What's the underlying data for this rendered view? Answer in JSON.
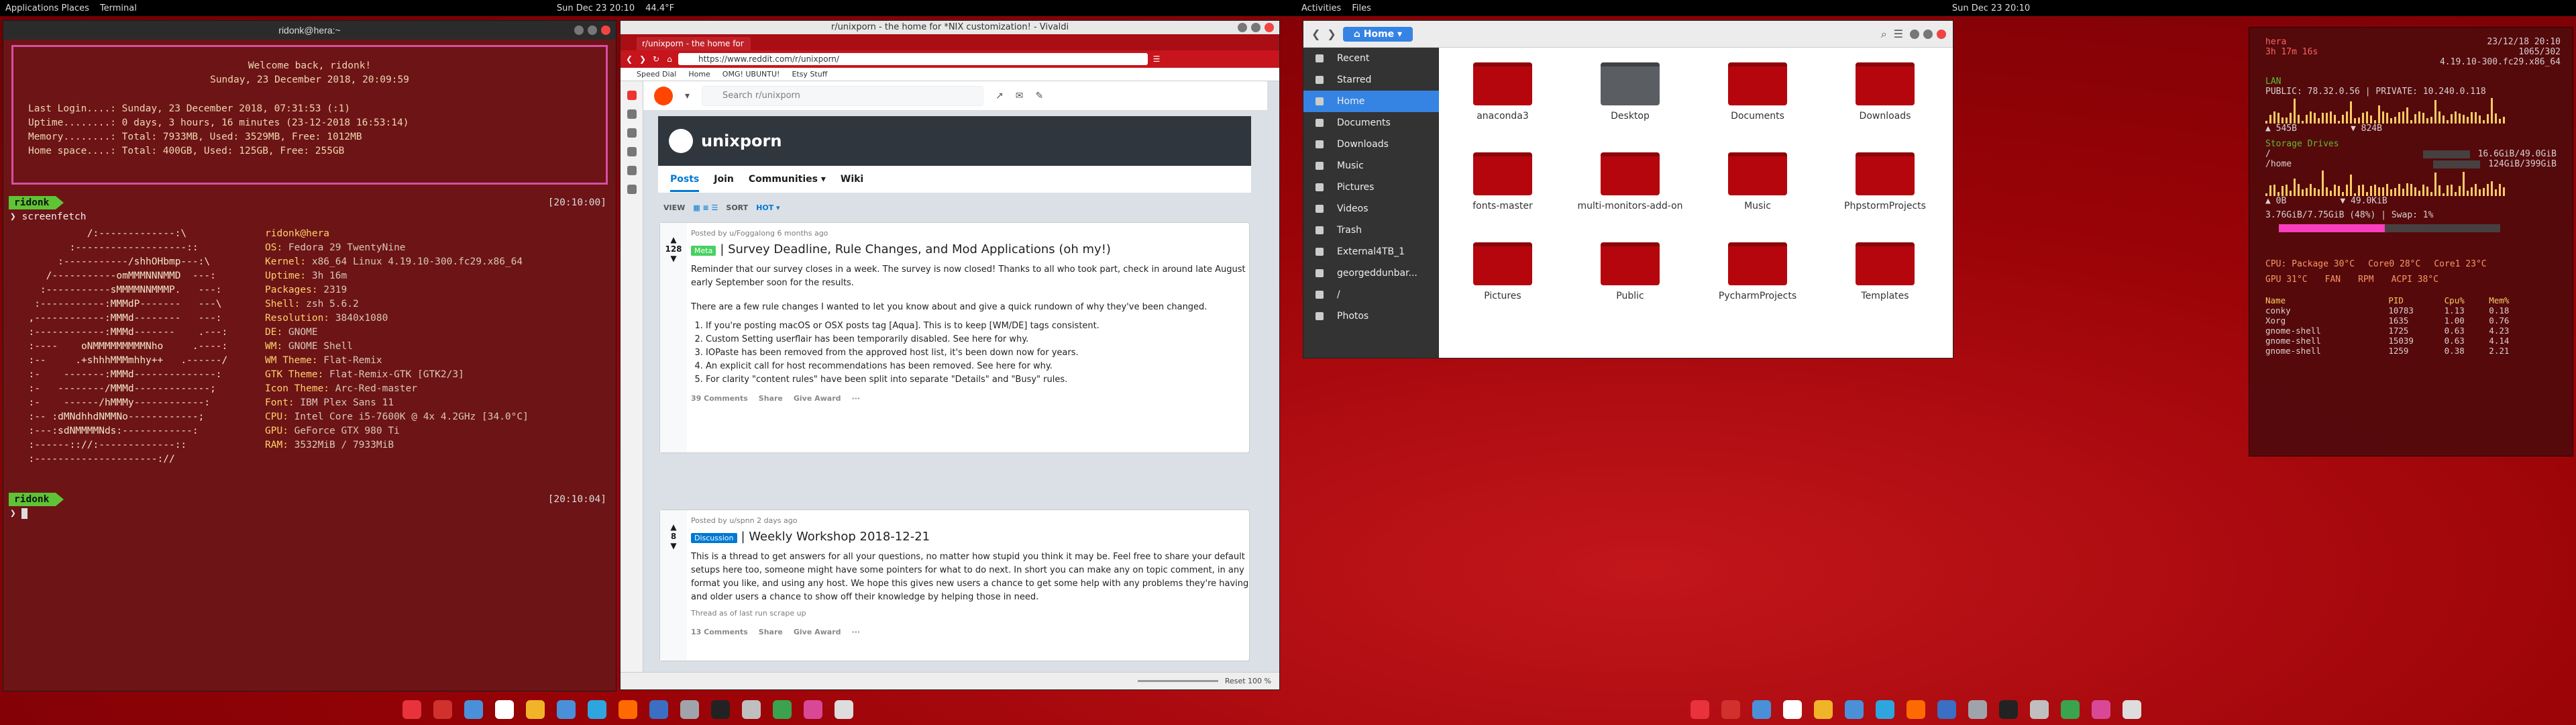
{
  "topbars": [
    {
      "left": "Applications  Places",
      "app": "Terminal",
      "clock": "Sun Dec 23  20:10",
      "extra": "44.4°F"
    },
    {
      "left": "Activities",
      "app": "Files",
      "clock": "Sun Dec 23  20:10",
      "extra": ""
    }
  ],
  "terminal": {
    "title": "ridonk@hera:~",
    "welcome_line1": "Welcome back, ridonk!",
    "welcome_line2": "Sunday, 23 December 2018, 20:09:59",
    "stats": [
      "Last Login....: Sunday, 23 December 2018, 07:31:53 (:1)",
      "Uptime........: 0 days, 3 hours, 16 minutes (23-12-2018 16:53:14)",
      "Memory........: Total: 7933MB, Used: 3529MB, Free: 1012MB",
      "Home space....: Total: 400GB, Used: 125GB, Free: 255GB"
    ],
    "prompt_user": "ridonk",
    "command": "screenfetch",
    "time1": "[20:10:00]",
    "time2": "[20:10:04]",
    "art": [
      "            /:-------------:\\",
      "         :-------------------::",
      "       :-----------/shhOHbmp---:\\",
      "     /-----------omMMMNNNMMD  ---:",
      "    :-----------sMMMMNNMMMP.   ---:",
      "   :-----------:MMMdP-------   ---\\",
      "  ,------------:MMMd--------   ---:",
      "  :------------:MMMd-------    .---:",
      "  :----    oNMMMMMMMMMNho     .----:",
      "  :--     .+shhhMMMmhhy++   .------/",
      "  :-    -------:MMMd--------------:",
      "  :-   --------/MMMd-------------;",
      "  :-    ------/hMMMy------------:",
      "  :-- :dMNdhhdNMMNo------------;",
      "  :---:sdNMMMMNds:------------:",
      "  :------:://:-------------::",
      "  :---------------------://"
    ],
    "info": [
      [
        "ridonk@hera",
        ""
      ],
      [
        "OS:",
        "Fedora 29 TwentyNine"
      ],
      [
        "Kernel:",
        "x86_64 Linux 4.19.10-300.fc29.x86_64"
      ],
      [
        "Uptime:",
        "3h 16m"
      ],
      [
        "Packages:",
        "2319"
      ],
      [
        "Shell:",
        "zsh 5.6.2"
      ],
      [
        "Resolution:",
        "3840x1080"
      ],
      [
        "DE:",
        "GNOME"
      ],
      [
        "WM:",
        "GNOME Shell"
      ],
      [
        "WM Theme:",
        "Flat-Remix"
      ],
      [
        "GTK Theme:",
        "Flat-Remix-GTK [GTK2/3]"
      ],
      [
        "Icon Theme:",
        "Arc-Red-master"
      ],
      [
        "Font:",
        "IBM Plex Sans 11"
      ],
      [
        "CPU:",
        "Intel Core i5-7600K @ 4x 4.2GHz [34.0°C]"
      ],
      [
        "GPU:",
        "GeForce GTX 980 Ti"
      ],
      [
        "RAM:",
        "3532MiB / 7933MiB"
      ]
    ]
  },
  "browser": {
    "title": "r/unixporn - the home for *NIX customization! - Vivaldi",
    "tab": "r/unixporn - the home for",
    "url": "https://www.reddit.com/r/unixporn/",
    "bookmarks": [
      "Speed Dial",
      "Home",
      "OMG! UBUNTU!",
      "Etsy Stuff"
    ],
    "search_placeholder": "Search r/unixporn",
    "sub_name": "unixporn",
    "nav": [
      "Posts",
      "Join",
      "Communities ▾",
      "Wiki"
    ],
    "view_label": "VIEW",
    "sort_label": "SORT",
    "sort_value": "HOT ▾",
    "post1": {
      "votes": "128",
      "meta": "Posted by u/Foggalong   6 months ago",
      "flair": "Meta",
      "title": "| Survey Deadline, Rule Changes, and Mod Applications (oh my!)",
      "intro": "Reminder that our survey closes in a week. The survey is now closed! Thanks to all who took part, check in around late August early September soon for the results.",
      "para": "There are a few rule changes I wanted to let you know about and give a quick rundown of why they've been changed.",
      "items": [
        "If you're posting macOS or OSX posts tag [Aqua]. This is to keep [WM/DE] tags consistent.",
        "Custom Setting userflair has been temporarily disabled. See here for why.",
        "IOPaste has been removed from the approved host list, it's been down now for years.",
        "An explicit call for host recommendations has been removed. See here for why.",
        "For clarity \"content rules\" have been split into separate \"Details\" and \"Busy\" rules."
      ],
      "footer": [
        "39 Comments",
        "Share",
        "Give Award",
        "···"
      ]
    },
    "post2": {
      "votes": "8",
      "meta": "Posted by u/spnn   2 days ago",
      "flair": "Discussion",
      "title": "| Weekly Workshop 2018-12-21",
      "para": "This is a thread to get answers for all your questions, no matter how stupid you think it may be. Feel free to share your default setups here too, someone might have some pointers for what to do next. In short you can make any on topic comment, in any format you like, and using any host. We hope this gives new users a chance to get some help with any problems they're having and older users a chance to show off their knowledge by helping those in need.",
      "small": "Thread as of last run scrape up",
      "footer": [
        "13 Comments",
        "Share",
        "Give Award",
        "···"
      ]
    },
    "status": "Reset  100 %"
  },
  "files": {
    "breadcrumb": "⌂ Home ▾",
    "sidebar": [
      "Recent",
      "Starred",
      "Home",
      "Documents",
      "Downloads",
      "Music",
      "Pictures",
      "Videos",
      "Trash",
      "External4TB_1",
      "georgeddunbar...",
      "/",
      "Photos"
    ],
    "items": [
      "anaconda3",
      "Desktop",
      "Documents",
      "Downloads",
      "fonts-master",
      "multi-monitors-add-on",
      "Music",
      "PhpstormProjects",
      "Pictures",
      "Public",
      "PycharmProjects",
      "Templates"
    ]
  },
  "conky": {
    "date": "23/12/18",
    "time": "20:10",
    "host": "hera",
    "uptime": "3h 17m 16s",
    "procs": "1065/302",
    "kernel": "4.19.10-300.fc29.x86_64",
    "lan_label": "LAN",
    "public_ip": "PUBLIC: 78.32.0.56",
    "private_ip": "PRIVATE: 10.240.0.118",
    "up": "545B",
    "down": "824B",
    "storage_label": "Storage Drives",
    "drives": [
      [
        "/",
        "16.6GiB/49.0GiB"
      ],
      [
        "/home",
        "124GiB/399GiB"
      ]
    ],
    "io_read": "0B",
    "io_write": "49.0KiB",
    "mem": "3.76GiB/7.75GiB (48%) | Swap: 1%",
    "mem_fraction": 0.48,
    "temps": [
      "CPU: Package 30°C",
      "Core0 28°C",
      "Core1 23°C"
    ],
    "gpu": [
      "GPU 31°C",
      "FAN",
      "RPM",
      "ACPI 38°C"
    ],
    "proc_head": [
      "Name",
      "PID",
      "Cpu%",
      "Mem%"
    ],
    "procs_list": [
      [
        "conky",
        "10783",
        "1.13",
        "0.18"
      ],
      [
        "Xorg",
        "1635",
        "1.00",
        "0.76"
      ],
      [
        "gnome-shell",
        "1725",
        "0.63",
        "4.23"
      ],
      [
        "gnome-shell",
        "15039",
        "0.63",
        "4.14"
      ],
      [
        "gnome-shell",
        "1259",
        "0.38",
        "2.21"
      ]
    ]
  },
  "dock_colors": [
    "#e8323c",
    "#d0312d",
    "#4a90d9",
    "#ffffff",
    "#f0b429",
    "#4a90d9",
    "#2fa5e0",
    "#ff6a00",
    "#3a6fc4",
    "#9fa4aa",
    "#222222",
    "#bfbfbf",
    "#3aa34d",
    "#d94896",
    "#dddddd"
  ]
}
